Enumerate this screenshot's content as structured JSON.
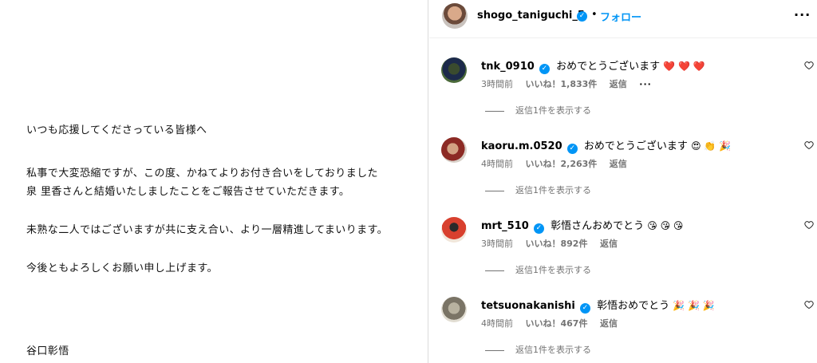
{
  "letter": {
    "lines": [
      "いつも応援してくださっている皆様へ",
      "私事で大変恐縮ですが、この度、かねてよりお付き合いをしておりました",
      "泉 里香さんと結婚いたしましたことをご報告させていただきます。",
      "未熟な二人ではございますが共に支え合い、より一層精進してまいります。",
      "今後ともよろしくお願い申し上げます。",
      "谷口彰悟"
    ]
  },
  "header": {
    "username": "shogo_taniguchi_5",
    "separator": "•",
    "follow_label": "フォロー",
    "more_label": "···"
  },
  "comments": [
    {
      "username": "tnk_0910",
      "text": "おめでとうございます",
      "emojis": "❤️ ❤️ ❤️",
      "time": "3時間前",
      "likes": "いいね！1,833件",
      "reply": "返信",
      "options": "···",
      "view_replies": "返信1件を表示する"
    },
    {
      "username": "kaoru.m.0520",
      "text": "おめでとうございます",
      "emojis": "😍 👏 🎉",
      "time": "4時間前",
      "likes": "いいね！2,263件",
      "reply": "返信",
      "options": "",
      "view_replies": "返信1件を表示する"
    },
    {
      "username": "mrt_510",
      "text": "彰悟さんおめでとう",
      "emojis": "😘 😘 😘",
      "time": "3時間前",
      "likes": "いいね！892件",
      "reply": "返信",
      "options": "",
      "view_replies": "返信1件を表示する"
    },
    {
      "username": "tetsuonakanishi",
      "text": "彰悟おめでとう",
      "emojis": "🎉 🎉 🎉",
      "time": "4時間前",
      "likes": "いいね！467件",
      "reply": "返信",
      "options": "",
      "view_replies": "返信1件を表示する"
    }
  ],
  "icons": {
    "verified": "verified-badge-icon",
    "heart": "heart-outline-icon"
  },
  "colors": {
    "accent": "#0095f6",
    "muted": "#737373",
    "heart_emoji": "#e0245e"
  }
}
